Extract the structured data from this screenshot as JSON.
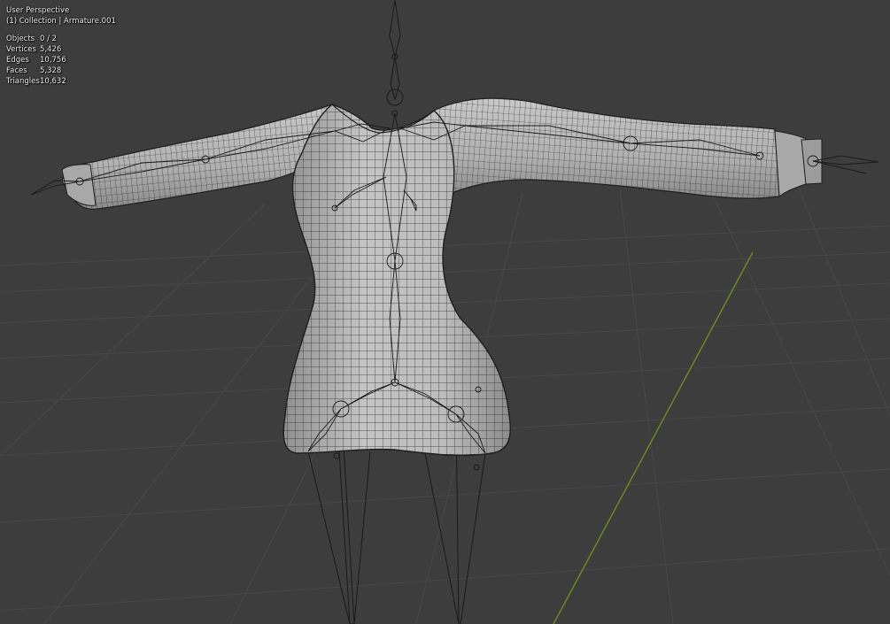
{
  "viewport": {
    "view_name": "User Perspective",
    "context": "(1) Collection | Armature.001"
  },
  "stats": [
    {
      "label": "Objects",
      "value": "0 / 2"
    },
    {
      "label": "Vertices",
      "value": "5,426"
    },
    {
      "label": "Edges",
      "value": "10,756"
    },
    {
      "label": "Faces",
      "value": "5,328"
    },
    {
      "label": "Triangles",
      "value": "10,632"
    }
  ],
  "colors": {
    "background": "#3d3d3d",
    "grid": "#4a4a4a",
    "axis_y": "#6b8e23",
    "mesh_fill": "#b4b4b4",
    "wire": "#1e1e1e"
  }
}
